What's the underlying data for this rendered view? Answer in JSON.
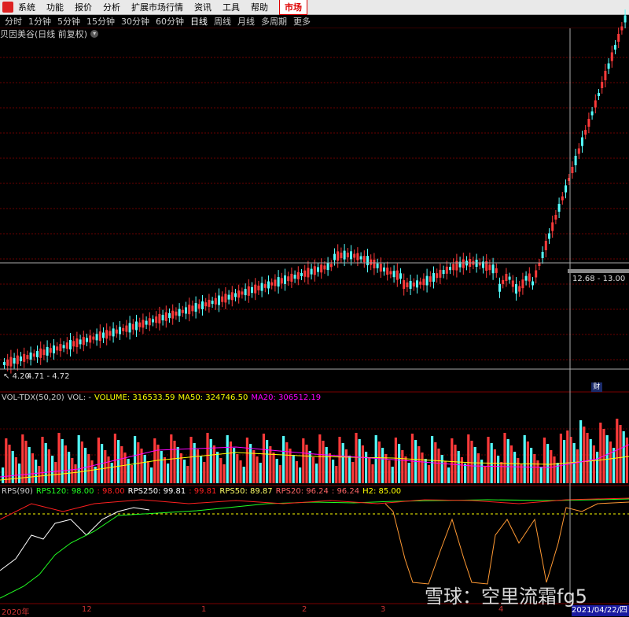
{
  "menu": [
    "系统",
    "功能",
    "报价",
    "分析",
    "扩展市场行情",
    "资讯",
    "工具",
    "帮助"
  ],
  "menu_market": "市场",
  "periods": [
    "分时",
    "1分钟",
    "5分钟",
    "15分钟",
    "30分钟",
    "60分钟",
    "日线",
    "周线",
    "月线",
    "多周期",
    "更多"
  ],
  "active_period": "日线",
  "stock_title": "贝因美谷(日线 前复权)",
  "price_range_top": "12.68 - 13.00",
  "price_range_low": "4.20",
  "price_range_low2": "4.71 - 4.72",
  "fin_badge": "财",
  "vol_indicator": {
    "name": "VOL-TDX(50,20)",
    "vol": "VOL: -",
    "volume": "VOLUME: 316533.59",
    "ma50": "MA50: 324746.50",
    "ma20": "MA20: 306512.19"
  },
  "rps_indicator": {
    "name": "RPS(90)",
    "rps120": "RPS120: 98.00",
    "rps120b": ": 98.00",
    "rps250": "RPS250: 99.81",
    "rps250b": ": 99.81",
    "rps50": "RPS50: 89.87",
    "rps20": "RPS20: 96.24",
    "rps20b": ": 96.24",
    "h2": "H2: 85.00"
  },
  "x_axis": [
    "2020年",
    "12",
    "1",
    "2",
    "3",
    "4"
  ],
  "crosshair_date": "2021/04/22/四",
  "watermark": "雪球：空里流霜fg5",
  "colors": {
    "up": "#ff3a3a",
    "down": "#54ffff",
    "ma20": "#ff00ff",
    "ma50": "#ffff00",
    "rps120": "#ffffff",
    "rps250": "#ff2020",
    "rps50": "#22ff22",
    "rps20": "#ff9933",
    "h2": "#ffff00"
  }
}
